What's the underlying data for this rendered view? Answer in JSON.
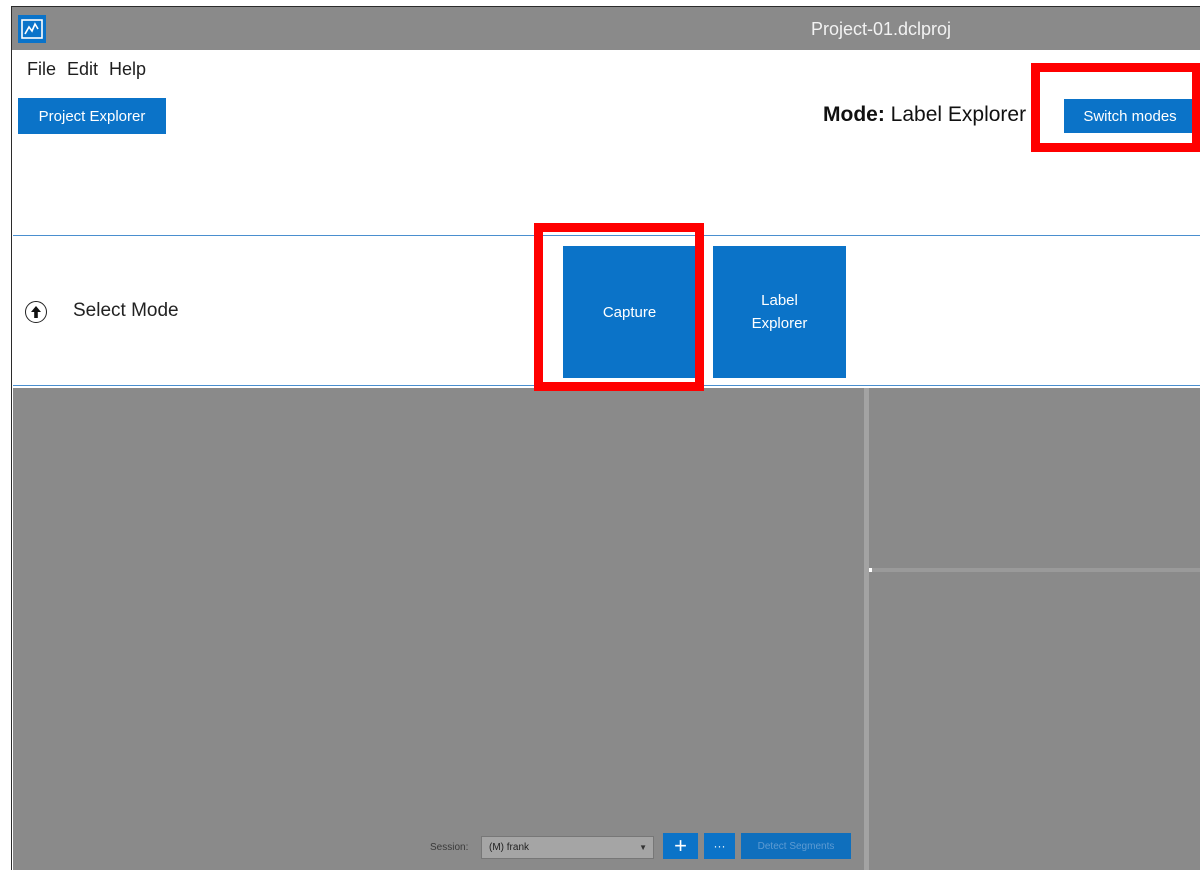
{
  "window": {
    "title": "Project-01.dclproj",
    "logo_icon": "chart-icon"
  },
  "menu": [
    "File",
    "Edit",
    "Help"
  ],
  "toolbar": {
    "project_explorer": "Project Explorer",
    "mode_prefix": "Mode:",
    "mode_value": " Label Explorer",
    "switch_modes": "Switch modes"
  },
  "select_mode": {
    "icon": "arrow-up-circle-icon",
    "label": "Select Mode",
    "tiles": [
      {
        "line1": "Capture",
        "line2": ""
      },
      {
        "line1": "Label",
        "line2": "Explorer"
      }
    ]
  },
  "session_bar": {
    "label": "Session:",
    "value": "(M) frank",
    "add": "+",
    "more": "···",
    "detect": "Detect Segments"
  },
  "colors": {
    "accent": "#0b73c8",
    "highlight": "#ff0000",
    "titlebar": "#8a8a8a",
    "workspace": "#8a8a8a"
  }
}
